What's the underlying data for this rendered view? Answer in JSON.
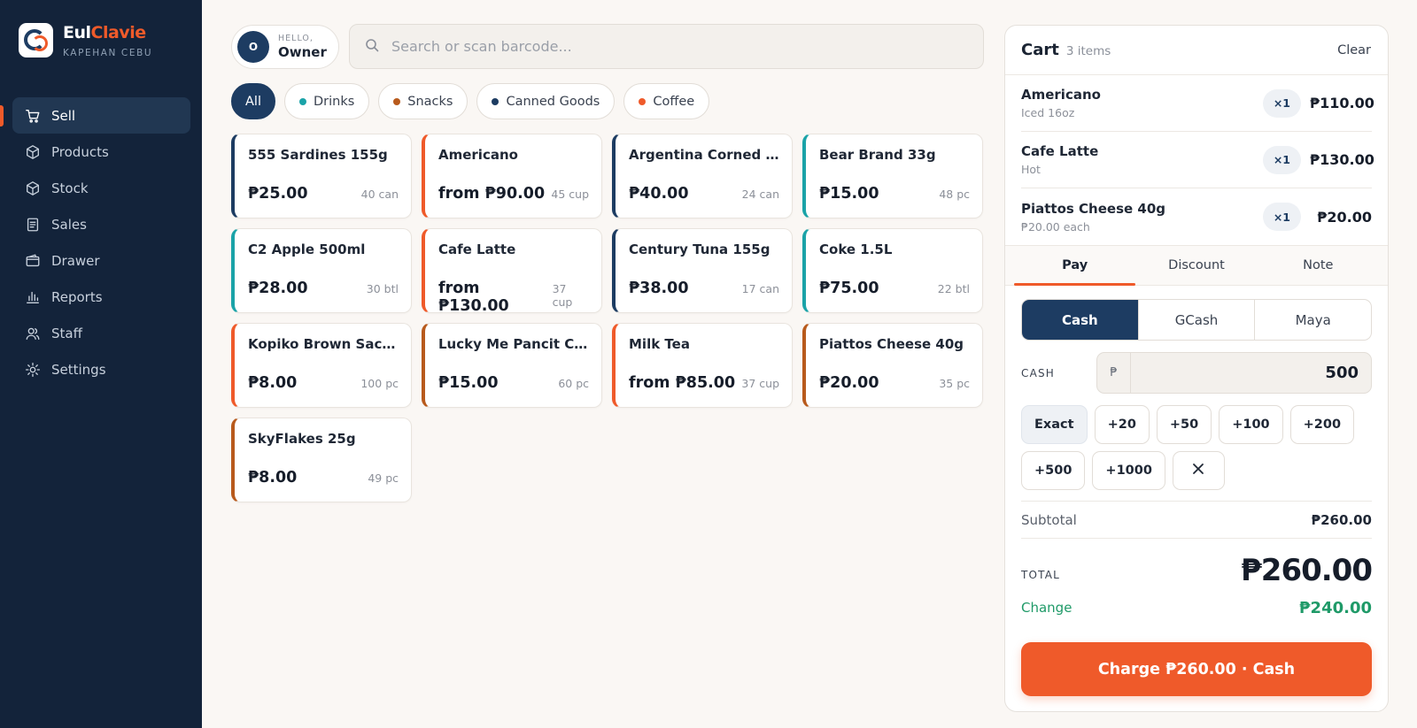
{
  "brand": {
    "name_part1": "Eul",
    "name_part2": "Clavie",
    "subtitle": "KAPEHAN CEBU"
  },
  "nav": {
    "items": [
      {
        "label": "Sell",
        "icon": "cart-icon",
        "active": true
      },
      {
        "label": "Products",
        "icon": "box-icon",
        "active": false
      },
      {
        "label": "Stock",
        "icon": "box-icon",
        "active": false
      },
      {
        "label": "Sales",
        "icon": "receipt-icon",
        "active": false
      },
      {
        "label": "Drawer",
        "icon": "wallet-icon",
        "active": false
      },
      {
        "label": "Reports",
        "icon": "bar-chart-icon",
        "active": false
      },
      {
        "label": "Staff",
        "icon": "users-icon",
        "active": false
      },
      {
        "label": "Settings",
        "icon": "gear-icon",
        "active": false
      }
    ]
  },
  "user": {
    "initial": "O",
    "greeting": "HELLO,",
    "name": "Owner"
  },
  "search": {
    "placeholder": "Search or scan barcode...",
    "value": ""
  },
  "filters": [
    {
      "label": "All",
      "active": true,
      "dot": ""
    },
    {
      "label": "Drinks",
      "active": false,
      "dot": "#1aa3a8"
    },
    {
      "label": "Snacks",
      "active": false,
      "dot": "#b85a1c"
    },
    {
      "label": "Canned Goods",
      "active": false,
      "dot": "#1d3c62"
    },
    {
      "label": "Coffee",
      "active": false,
      "dot": "#ef5a2a"
    }
  ],
  "products": [
    {
      "name": "555 Sardines 155g",
      "price": "₱25.00",
      "stock": "40 can",
      "accent": "#1d3c62"
    },
    {
      "name": "Americano",
      "price": "from ₱90.00",
      "stock": "45 cup",
      "accent": "#ef5a2a"
    },
    {
      "name": "Argentina Corned Be...",
      "price": "₱40.00",
      "stock": "24 can",
      "accent": "#1d3c62"
    },
    {
      "name": "Bear Brand 33g",
      "price": "₱15.00",
      "stock": "48 pc",
      "accent": "#1aa3a8"
    },
    {
      "name": "C2 Apple 500ml",
      "price": "₱28.00",
      "stock": "30 btl",
      "accent": "#1aa3a8"
    },
    {
      "name": "Cafe Latte",
      "price": "from ₱130.00",
      "stock": "37 cup",
      "accent": "#ef5a2a"
    },
    {
      "name": "Century Tuna 155g",
      "price": "₱38.00",
      "stock": "17 can",
      "accent": "#1d3c62"
    },
    {
      "name": "Coke 1.5L",
      "price": "₱75.00",
      "stock": "22 btl",
      "accent": "#1aa3a8"
    },
    {
      "name": "Kopiko Brown Sachet",
      "price": "₱8.00",
      "stock": "100 pc",
      "accent": "#ef5a2a"
    },
    {
      "name": "Lucky Me Pancit Can...",
      "price": "₱15.00",
      "stock": "60 pc",
      "accent": "#b85a1c"
    },
    {
      "name": "Milk Tea",
      "price": "from ₱85.00",
      "stock": "37 cup",
      "accent": "#ef5a2a"
    },
    {
      "name": "Piattos Cheese 40g",
      "price": "₱20.00",
      "stock": "35 pc",
      "accent": "#b85a1c"
    },
    {
      "name": "SkyFlakes 25g",
      "price": "₱8.00",
      "stock": "49 pc",
      "accent": "#b85a1c"
    }
  ],
  "cart": {
    "title": "Cart",
    "count": "3 items",
    "clear_label": "Clear",
    "lines": [
      {
        "name": "Americano",
        "sub": "Iced 16oz",
        "qty": "×1",
        "total": "₱110.00"
      },
      {
        "name": "Cafe Latte",
        "sub": "Hot",
        "qty": "×1",
        "total": "₱130.00"
      },
      {
        "name": "Piattos Cheese 40g",
        "sub": "₱20.00 each",
        "qty": "×1",
        "total": "₱20.00"
      }
    ],
    "tabs": [
      {
        "label": "Pay",
        "active": true
      },
      {
        "label": "Discount",
        "active": false
      },
      {
        "label": "Note",
        "active": false
      }
    ],
    "payment_methods": [
      {
        "label": "Cash",
        "active": true
      },
      {
        "label": "GCash",
        "active": false
      },
      {
        "label": "Maya",
        "active": false
      }
    ],
    "cash_label": "CASH",
    "currency_symbol": "₱",
    "cash_value": "500",
    "quick_amounts": [
      "Exact",
      "+20",
      "+50",
      "+100",
      "+200",
      "+500",
      "+1000"
    ],
    "subtotal_label": "Subtotal",
    "subtotal": "₱260.00",
    "total_label": "TOTAL",
    "total": "₱260.00",
    "change_label": "Change",
    "change": "₱240.00",
    "charge_label": "Charge ₱260.00 · Cash"
  },
  "colors": {
    "navy": "#1d3c62",
    "sidebar": "#13233a",
    "accent": "#ef5a2a",
    "teal": "#1aa3a8",
    "brown": "#b85a1c",
    "green": "#1f9a68"
  }
}
